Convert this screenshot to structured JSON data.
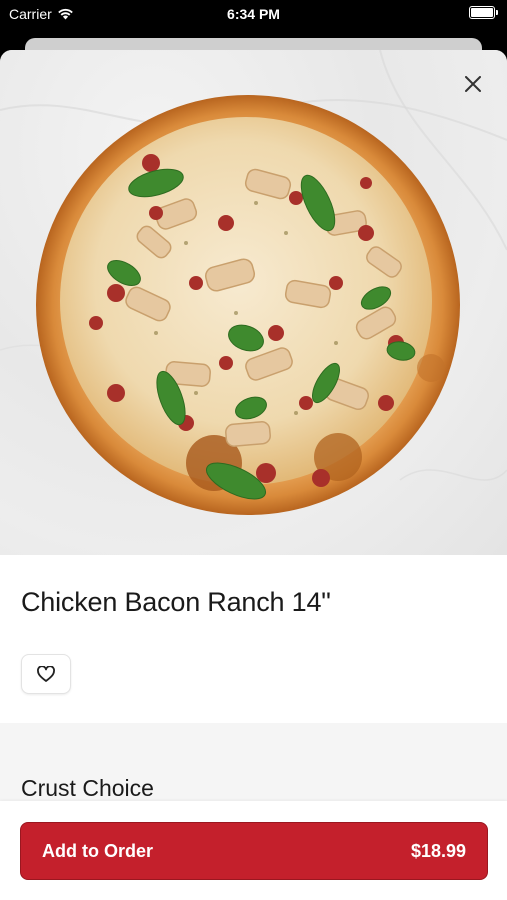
{
  "status_bar": {
    "carrier": "Carrier",
    "time": "6:34 PM"
  },
  "product": {
    "name": "Chicken Bacon Ranch 14\"",
    "image_icon": "pizza-photo"
  },
  "sections": {
    "crust_title": "Crust Choice"
  },
  "footer": {
    "add_label": "Add to Order",
    "price": "$18.99"
  },
  "colors": {
    "brand_red": "#c4202c"
  }
}
